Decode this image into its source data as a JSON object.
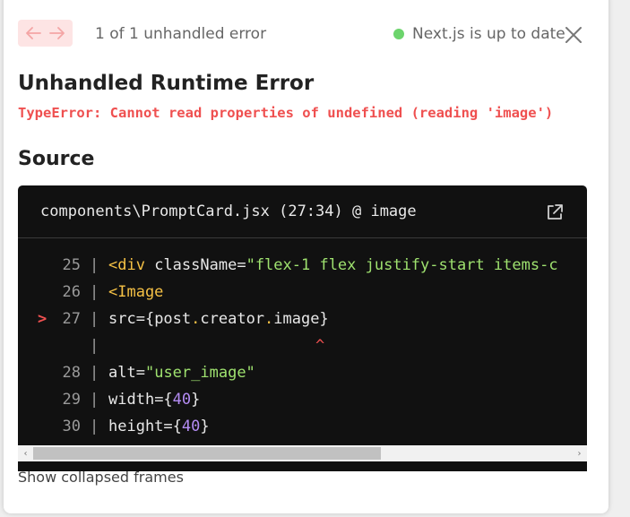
{
  "header": {
    "prev_icon": "arrow-left-icon",
    "next_icon": "arrow-right-icon",
    "pagination": "1 of 1 unhandled error",
    "version_status": "Next.js is up to date",
    "status_color": "#6cd46c",
    "close_icon": "close-icon"
  },
  "error": {
    "title": "Unhandled Runtime Error",
    "message": "TypeError: Cannot read properties of undefined (reading 'image')"
  },
  "source": {
    "heading": "Source",
    "file": "components\\PromptCard.jsx (27:34) @ image",
    "open_icon": "external-link-icon",
    "lines": [
      {
        "num": "25",
        "marker": "",
        "code": "<div className=\"flex-1 flex justify-start items-c"
      },
      {
        "num": "26",
        "marker": "",
        "code": "  <Image"
      },
      {
        "num": "27",
        "marker": ">",
        "code": "    src={post.creator.image}"
      },
      {
        "num": "",
        "marker": "",
        "code": "^"
      },
      {
        "num": "28",
        "marker": "",
        "code": "    alt=\"user_image\""
      },
      {
        "num": "29",
        "marker": "",
        "code": "    width={40}"
      },
      {
        "num": "30",
        "marker": "",
        "code": "    height={40}"
      }
    ]
  },
  "footer": {
    "collapsed_label": "Show collapsed frames"
  },
  "colors": {
    "accent_error": "#ef5050",
    "code_bg": "#111111",
    "tag": "#f5c145",
    "string": "#9fe26f",
    "number": "#b48cf3"
  }
}
